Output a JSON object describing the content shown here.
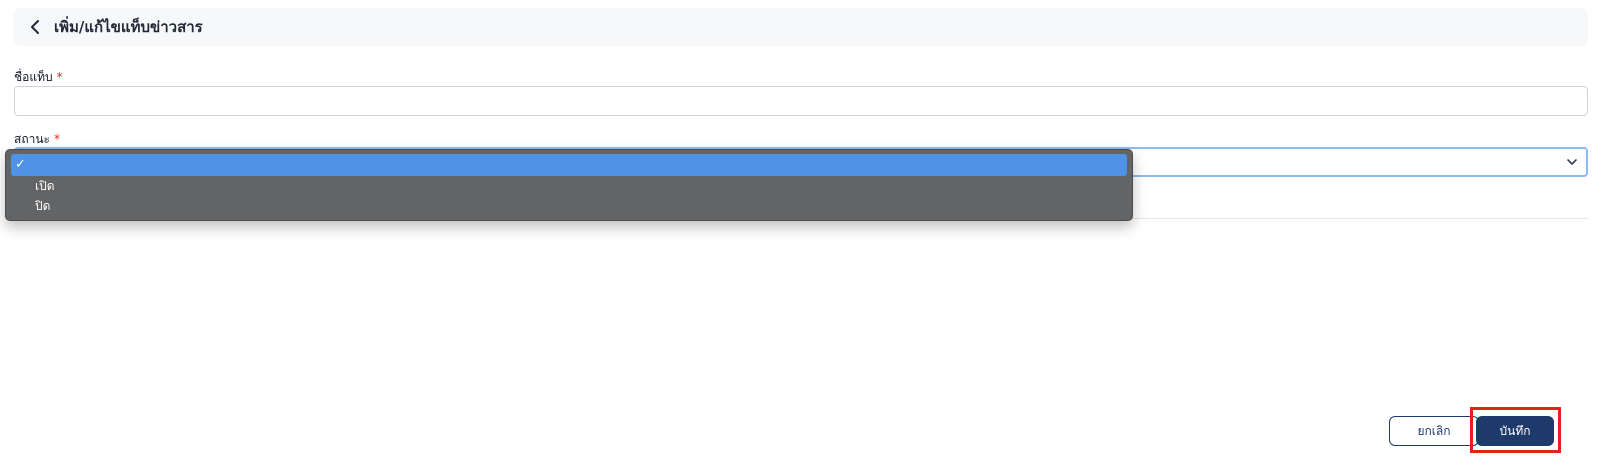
{
  "header": {
    "title": "เพิ่ม/แก้ไขแท็บข่าวสาร",
    "back_icon": "chevron-left-icon"
  },
  "form": {
    "tag_name": {
      "label": "ชื่อแท็บ",
      "required_mark": "*",
      "value": "",
      "placeholder": ""
    },
    "status": {
      "label": "สถานะ",
      "required_mark": "*",
      "selected_value": "",
      "chevron_icon": "chevron-down-icon",
      "options": [
        {
          "label": "",
          "selected": true
        },
        {
          "label": "เปิด",
          "selected": false
        },
        {
          "label": "ปิด",
          "selected": false
        }
      ],
      "check_mark": "✓"
    }
  },
  "actions": {
    "cancel_label": "ยกเลิก",
    "save_label": "บันทึก"
  },
  "colors": {
    "primary": "#1e3a6b",
    "required": "#dc2626",
    "dropdown_bg": "#636466",
    "dropdown_selected": "#4f93e6",
    "highlight": "#e8201b"
  }
}
